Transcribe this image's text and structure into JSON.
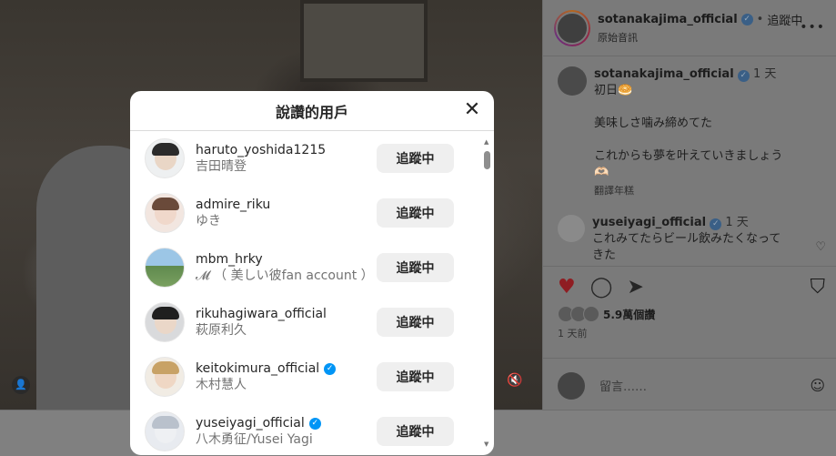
{
  "post": {
    "username": "sotanakajima_official",
    "follow_state": "追蹤中",
    "sub_label": "原始音訊",
    "caption": {
      "username": "sotanakajima_official",
      "time": "1 天",
      "lines": [
        "初日🥯",
        "",
        "美味しさ噛み締めてた",
        "",
        "これからも夢を叶えていきましょう",
        "🫶🏻"
      ],
      "translate": "翻譯年糕"
    },
    "comment": {
      "username": "yuseiyagi_official",
      "time": "1 天",
      "text": "これみてたらビール飲みたくなってきた"
    },
    "likes": "5.9萬個讚",
    "posted": "1 天前",
    "comment_placeholder": "留言……"
  },
  "modal": {
    "title": "說讚的用戶",
    "users": [
      {
        "username": "haruto_yoshida1215",
        "fullname": "吉田晴登",
        "verified": false,
        "button": "追蹤中"
      },
      {
        "username": "admire_riku",
        "fullname": "ゆき",
        "verified": false,
        "button": "追蹤中"
      },
      {
        "username": "mbm_hrky",
        "fullname": "𝓜 （ 美しい彼fan account ）",
        "verified": false,
        "button": "追蹤中"
      },
      {
        "username": "rikuhagiwara_official",
        "fullname": "萩原利久",
        "verified": false,
        "button": "追蹤中"
      },
      {
        "username": "keitokimura_official",
        "fullname": "木村慧人",
        "verified": true,
        "button": "追蹤中"
      },
      {
        "username": "yuseiyagi_official",
        "fullname": "八木勇征/Yusei Yagi",
        "verified": true,
        "button": "追蹤中"
      }
    ]
  },
  "colors": {
    "accent": "#0095f6",
    "like": "#ed4956"
  }
}
